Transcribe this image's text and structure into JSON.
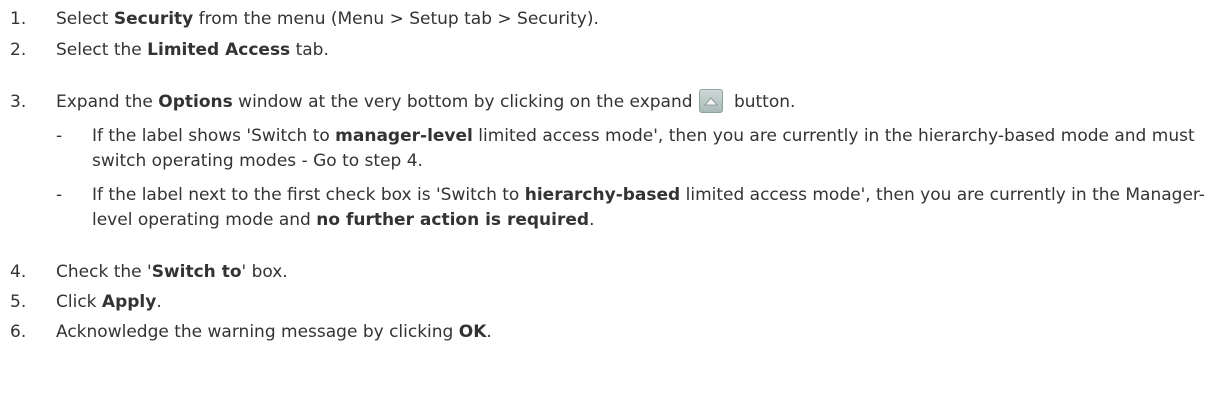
{
  "steps": [
    {
      "num": "1.",
      "pre": "Select ",
      "bold": "Security",
      "post": " from the menu (Menu > Setup tab > Security)."
    },
    {
      "num": "2.",
      "pre": "Select the ",
      "bold": "Limited Access",
      "post": " tab."
    },
    {
      "num": "3.",
      "pre": "Expand the ",
      "bold": "Options",
      "mid": " window at the very bottom by clicking on the expand",
      "post": " button."
    },
    {
      "num": "4.",
      "pre": "Check the '",
      "bold": "Switch to",
      "post": "' box."
    },
    {
      "num": "5.",
      "pre": "Click ",
      "bold": "Apply",
      "post": "."
    },
    {
      "num": "6.",
      "pre": "Acknowledge the warning message by clicking ",
      "bold": "OK",
      "post": "."
    }
  ],
  "substeps": [
    {
      "dash": "-",
      "pre": "If the label shows 'Switch to ",
      "bold": "manager-level",
      "post": " limited access mode', then you are currently in the hierarchy-based mode and must switch operating modes - Go to step 4."
    },
    {
      "dash": "-",
      "pre": "If the label next to the first check box is 'Switch to ",
      "bold": "hierarchy-based",
      "mid": " limited access mode', then you are currently in the Manager-level operating mode and ",
      "bold2": "no further action is required",
      "post": "."
    }
  ],
  "icons": {
    "expand_button": "expand-up-arrow-icon"
  }
}
